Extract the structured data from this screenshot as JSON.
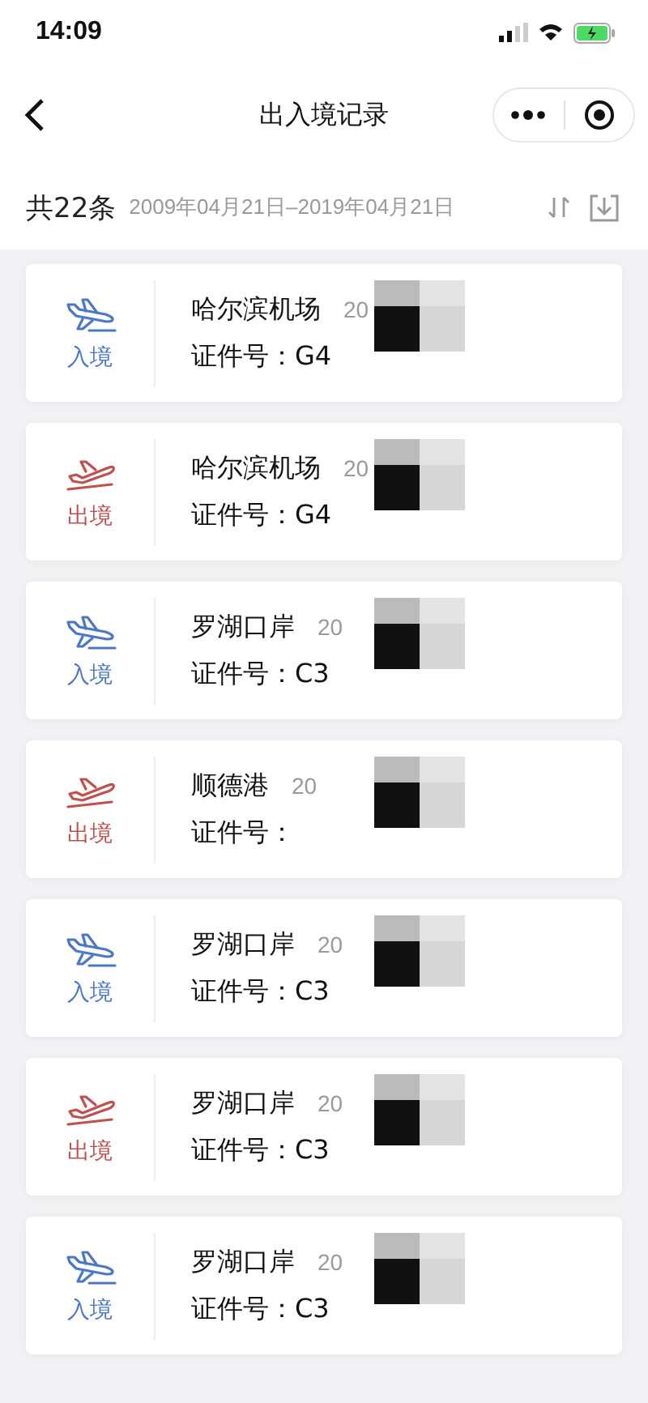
{
  "status_bar": {
    "time": "14:09"
  },
  "nav": {
    "title": "出入境记录"
  },
  "summary": {
    "count": "共22条",
    "range": "2009年04月21日–2019年04月21日"
  },
  "records": [
    {
      "kind": "entry",
      "label": "入境",
      "place": "哈尔滨机场",
      "date": "20",
      "cert": "证件号：G4",
      "redacted": true
    },
    {
      "kind": "exit",
      "label": "出境",
      "place": "哈尔滨机场",
      "date": "20",
      "cert": "证件号：G4",
      "redacted": true
    },
    {
      "kind": "entry",
      "label": "入境",
      "place": "罗湖口岸",
      "date": "20",
      "cert": "证件号：C3",
      "redacted": true
    },
    {
      "kind": "exit",
      "label": "出境",
      "place": "顺德港",
      "date": "20",
      "cert": "证件号：",
      "redacted": true
    },
    {
      "kind": "entry",
      "label": "入境",
      "place": "罗湖口岸",
      "date": "20",
      "cert": "证件号：C3",
      "redacted": true
    },
    {
      "kind": "exit",
      "label": "出境",
      "place": "罗湖口岸",
      "date": "20",
      "cert": "证件号：C3",
      "redacted": true
    },
    {
      "kind": "entry",
      "label": "入境",
      "place": "罗湖口岸",
      "date": "20",
      "cert": "证件号：C3",
      "redacted": true
    }
  ]
}
